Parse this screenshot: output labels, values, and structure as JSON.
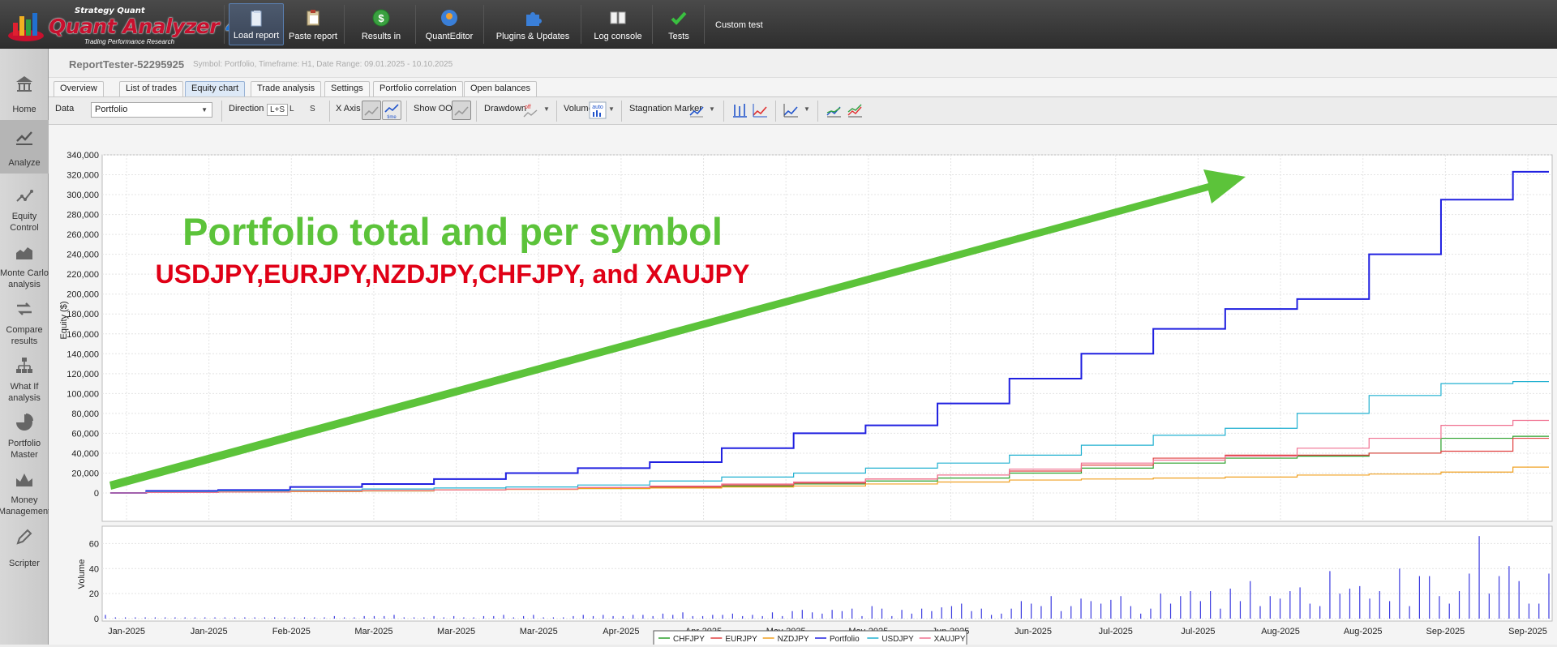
{
  "app": {
    "logo_top": "Strategy Quant",
    "logo_name": "Quant Analyzer",
    "logo_version": "4",
    "logo_tagline": "Trading Performance Research"
  },
  "toolbar": {
    "load_report": "Load report",
    "paste_report": "Paste report",
    "results_in": "Results in",
    "quant_editor": "QuantEditor",
    "plugins_updates": "Plugins & Updates",
    "log_console": "Log console",
    "tests": "Tests",
    "custom_test": "Custom test"
  },
  "sidebar": {
    "items": [
      {
        "label": "Home"
      },
      {
        "label": "Analyze"
      },
      {
        "label": "Equity Control"
      },
      {
        "label": "Monte Carlo analysis"
      },
      {
        "label": "Compare results"
      },
      {
        "label": "What If analysis"
      },
      {
        "label": "Portfolio Master"
      },
      {
        "label": "Money Management"
      },
      {
        "label": "Scripter"
      }
    ]
  },
  "report": {
    "title": "ReportTester-52295925",
    "subtitle": "Symbol: Portfolio, Timeframe: H1, Date Range: 09.01.2025 - 10.10.2025"
  },
  "tabs": [
    "Overview",
    "List of trades",
    "Equity chart",
    "Trade analysis",
    "Settings",
    "Portfolio correlation",
    "Open balances"
  ],
  "controls": {
    "data_label": "Data",
    "data_value": "Portfolio",
    "direction_label": "Direction",
    "direction_options": [
      "L+S",
      "L",
      "S"
    ],
    "xaxis_label": "X Axis",
    "xaxis_time": "time",
    "show_oos_label": "Show OOS",
    "drawdown_label": "Drawdown",
    "drawdown_state": "off",
    "volume_label": "Volume",
    "volume_state": "auto",
    "stagnation_label": "Stagnation Marker"
  },
  "annotation": {
    "headline": "Portfolio total and per symbol",
    "symbols": "USDJPY,EURJPY,NZDJPY,CHFJPY, and XAUJPY",
    "arrow_color": "#5cc33a",
    "headline_color": "#5cc33a",
    "symbols_color": "#e00016"
  },
  "chart_data": {
    "type": "line",
    "ylabel": "Equity ($)",
    "ylim": [
      0,
      340000
    ],
    "yticks": [
      "340,000",
      "320,000",
      "300,000",
      "280,000",
      "260,000",
      "240,000",
      "220,000",
      "200,000",
      "180,000",
      "160,000",
      "140,000",
      "120,000",
      "100,000",
      "80,000",
      "60,000",
      "40,000",
      "20,000",
      "0"
    ],
    "xticks": [
      "Jan-2025",
      "Jan-2025",
      "Feb-2025",
      "Mar-2025",
      "Mar-2025",
      "Mar-2025",
      "Apr-2025",
      "Apr-2025",
      "May-2025",
      "May-2025",
      "Jun-2025",
      "Jun-2025",
      "Jul-2025",
      "Jul-2025",
      "Aug-2025",
      "Aug-2025",
      "Sep-2025",
      "Sep-2025"
    ],
    "x": [
      0,
      0.05,
      0.1,
      0.15,
      0.2,
      0.25,
      0.3,
      0.35,
      0.4,
      0.45,
      0.5,
      0.55,
      0.6,
      0.65,
      0.7,
      0.75,
      0.8,
      0.85,
      0.9,
      0.95,
      1.0
    ],
    "series": [
      {
        "name": "CHFJPY",
        "color": "#2aa02a",
        "values": [
          0,
          500,
          1000,
          1500,
          2000,
          3000,
          4000,
          4500,
          5500,
          7000,
          9000,
          12000,
          15000,
          20000,
          25000,
          30000,
          35000,
          37000,
          40000,
          55000,
          57000
        ]
      },
      {
        "name": "EURJPY",
        "color": "#e04040",
        "values": [
          0,
          500,
          1000,
          1500,
          2500,
          3000,
          4000,
          5000,
          6000,
          8000,
          10000,
          14000,
          18000,
          22000,
          28000,
          35000,
          38000,
          38000,
          40000,
          42000,
          55000
        ]
      },
      {
        "name": "NZDJPY",
        "color": "#f0a020",
        "values": [
          0,
          500,
          1000,
          1500,
          2000,
          3000,
          3500,
          4500,
          5000,
          6000,
          7000,
          9000,
          11000,
          13000,
          14000,
          15000,
          16000,
          18000,
          19000,
          21000,
          26000
        ]
      },
      {
        "name": "Portfolio",
        "color": "#2020e0",
        "values": [
          0,
          2000,
          3000,
          6000,
          9000,
          14000,
          20000,
          25000,
          31000,
          45000,
          60000,
          68000,
          90000,
          115000,
          140000,
          165000,
          185000,
          195000,
          240000,
          295000,
          323000
        ]
      },
      {
        "name": "USDJPY",
        "color": "#20b0d0",
        "values": [
          0,
          1000,
          2000,
          3000,
          4000,
          5000,
          6000,
          8000,
          12000,
          16000,
          20000,
          25000,
          30000,
          38000,
          48000,
          58000,
          65000,
          80000,
          98000,
          110000,
          112000
        ]
      },
      {
        "name": "XAUJPY",
        "color": "#f07090",
        "values": [
          0,
          500,
          1000,
          2000,
          2500,
          3000,
          4000,
          5500,
          7000,
          9000,
          11000,
          14000,
          18000,
          24000,
          30000,
          33000,
          37000,
          45000,
          55000,
          68000,
          73000
        ]
      }
    ],
    "volume": {
      "ylabel": "Volume",
      "ylim": [
        0,
        70
      ],
      "yticks": [
        "60",
        "40",
        "20",
        "0"
      ],
      "values": [
        3,
        1,
        1,
        1,
        1,
        1,
        1,
        1,
        1,
        1,
        1,
        1,
        1,
        1,
        1,
        1,
        1,
        1,
        1,
        1,
        1,
        1,
        1,
        2,
        1,
        1,
        2,
        2,
        2,
        3,
        1,
        1,
        1,
        2,
        1,
        2,
        1,
        1,
        2,
        2,
        3,
        1,
        2,
        3,
        1,
        1,
        1,
        2,
        3,
        2,
        3,
        2,
        2,
        3,
        3,
        2,
        4,
        3,
        5,
        2,
        2,
        3,
        3,
        4,
        2,
        3,
        2,
        5,
        2,
        6,
        7,
        5,
        4,
        7,
        6,
        8,
        2,
        10,
        8,
        2,
        7,
        4,
        8,
        6,
        9,
        10,
        12,
        6,
        8,
        3,
        4,
        8,
        14,
        12,
        10,
        18,
        6,
        10,
        16,
        14,
        12,
        15,
        18,
        10,
        4,
        8,
        20,
        12,
        18,
        22,
        14,
        22,
        8,
        24,
        14,
        30,
        10,
        18,
        16,
        22,
        25,
        12,
        10,
        38,
        20,
        24,
        26,
        16,
        22,
        14,
        40,
        10,
        34,
        34,
        18,
        12,
        22,
        36,
        66,
        20,
        34,
        42,
        30,
        12,
        12,
        36
      ]
    }
  }
}
